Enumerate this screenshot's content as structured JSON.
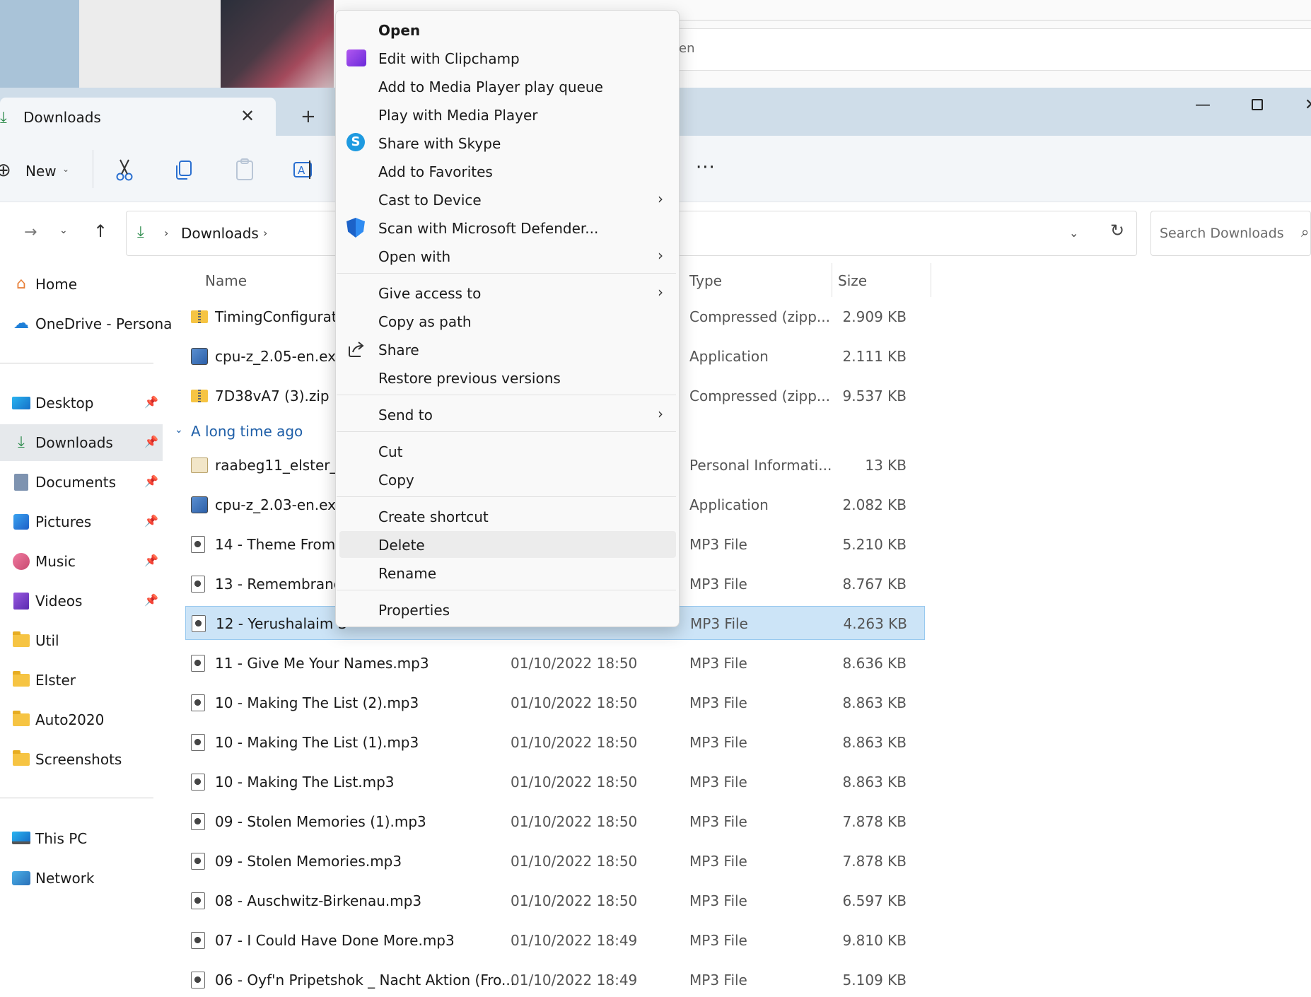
{
  "background": {
    "partial_text": "en"
  },
  "window": {
    "tab_title": "Downloads",
    "tab_close": "✕",
    "tab_add": "+",
    "minimize": "—",
    "close": "✕"
  },
  "toolbar": {
    "new_label": "New",
    "new_chevron": "⌄",
    "more": "···"
  },
  "address": {
    "forward": "→",
    "recent": "⌄",
    "up": "↑",
    "crumb": "Downloads",
    "chevron": "›",
    "dropdown": "⌄",
    "refresh": "↻",
    "search_placeholder": "Search Downloads",
    "search_icon": "⌕"
  },
  "sidebar": {
    "items": [
      {
        "label": "Home",
        "icon": "home-icon"
      },
      {
        "label": "OneDrive - Persona",
        "icon": "onedrive-icon"
      },
      {
        "label": "Desktop",
        "icon": "desktop-icon",
        "pinned": true
      },
      {
        "label": "Downloads",
        "icon": "download-icon",
        "pinned": true,
        "active": true
      },
      {
        "label": "Documents",
        "icon": "documents-icon",
        "pinned": true
      },
      {
        "label": "Pictures",
        "icon": "pictures-icon",
        "pinned": true
      },
      {
        "label": "Music",
        "icon": "music-icon",
        "pinned": true
      },
      {
        "label": "Videos",
        "icon": "videos-icon",
        "pinned": true
      },
      {
        "label": "Util",
        "icon": "folder-icon"
      },
      {
        "label": "Elster",
        "icon": "folder-icon"
      },
      {
        "label": "Auto2020",
        "icon": "folder-icon"
      },
      {
        "label": "Screenshots",
        "icon": "folder-icon"
      },
      {
        "label": "This PC",
        "icon": "pc-icon"
      },
      {
        "label": "Network",
        "icon": "network-icon"
      }
    ]
  },
  "filelist": {
    "headers": {
      "name": "Name",
      "type": "Type",
      "size": "Size"
    },
    "group_label": "A long time ago",
    "group_chevron": "⌄",
    "rows": [
      {
        "name": "TimingConfigurato",
        "date": "",
        "type": "Compressed (zipp...",
        "size": "2.909 KB",
        "icon": "zip"
      },
      {
        "name": "cpu-z_2.05-en.exe",
        "date": "",
        "type": "Application",
        "size": "2.111 KB",
        "icon": "exe"
      },
      {
        "name": "7D38vA7 (3).zip",
        "date": "",
        "type": "Compressed (zipp...",
        "size": "9.537 KB",
        "icon": "zip"
      },
      {
        "name": "raabeg11_elster_3(",
        "date": "",
        "type": "Personal Informati...",
        "size": "13 KB",
        "icon": "pim"
      },
      {
        "name": "cpu-z_2.03-en.exe",
        "date": "",
        "type": "Application",
        "size": "2.082 KB",
        "icon": "exe"
      },
      {
        "name": "14 - Theme From S",
        "date": "",
        "type": "MP3 File",
        "size": "5.210 KB",
        "icon": "mp3"
      },
      {
        "name": "13 - Remembrance",
        "date": "",
        "type": "MP3 File",
        "size": "8.767 KB",
        "icon": "mp3"
      },
      {
        "name": "12 - Yerushalaim S",
        "date": "",
        "type": "MP3 File",
        "size": "4.263 KB",
        "icon": "mp3",
        "selected": true
      },
      {
        "name": "11 - Give Me Your Names.mp3",
        "date": "01/10/2022 18:50",
        "type": "MP3 File",
        "size": "8.636 KB",
        "icon": "mp3"
      },
      {
        "name": "10 - Making The List (2).mp3",
        "date": "01/10/2022 18:50",
        "type": "MP3 File",
        "size": "8.863 KB",
        "icon": "mp3"
      },
      {
        "name": "10 - Making The List (1).mp3",
        "date": "01/10/2022 18:50",
        "type": "MP3 File",
        "size": "8.863 KB",
        "icon": "mp3"
      },
      {
        "name": "10 - Making The List.mp3",
        "date": "01/10/2022 18:50",
        "type": "MP3 File",
        "size": "8.863 KB",
        "icon": "mp3"
      },
      {
        "name": "09 - Stolen Memories (1).mp3",
        "date": "01/10/2022 18:50",
        "type": "MP3 File",
        "size": "7.878 KB",
        "icon": "mp3"
      },
      {
        "name": "09 - Stolen Memories.mp3",
        "date": "01/10/2022 18:50",
        "type": "MP3 File",
        "size": "7.878 KB",
        "icon": "mp3"
      },
      {
        "name": "08 - Auschwitz-Birkenau.mp3",
        "date": "01/10/2022 18:50",
        "type": "MP3 File",
        "size": "6.597 KB",
        "icon": "mp3"
      },
      {
        "name": "07 - I Could Have Done More.mp3",
        "date": "01/10/2022 18:49",
        "type": "MP3 File",
        "size": "9.810 KB",
        "icon": "mp3"
      },
      {
        "name": "06 - Oyf'n Pripetshok _ Nacht Aktion (Fro...",
        "date": "01/10/2022 18:49",
        "type": "MP3 File",
        "size": "5.109 KB",
        "icon": "mp3"
      }
    ]
  },
  "context_menu": {
    "items": [
      {
        "label": "Open",
        "bold": true
      },
      {
        "label": "Edit with Clipchamp",
        "icon": "clipchamp-icon"
      },
      {
        "label": "Add to Media Player play queue"
      },
      {
        "label": "Play with Media Player"
      },
      {
        "label": "Share with Skype",
        "icon": "skype-icon"
      },
      {
        "label": "Add to Favorites"
      },
      {
        "label": "Cast to Device",
        "submenu": true
      },
      {
        "label": "Scan with Microsoft Defender...",
        "icon": "defender-shield-icon"
      },
      {
        "label": "Open with",
        "submenu": true
      },
      {
        "label": "Give access to",
        "submenu": true
      },
      {
        "label": "Copy as path"
      },
      {
        "label": "Share",
        "icon": "share-icon"
      },
      {
        "label": "Restore previous versions"
      },
      {
        "label": "Send to",
        "submenu": true
      },
      {
        "label": "Cut"
      },
      {
        "label": "Copy"
      },
      {
        "label": "Create shortcut"
      },
      {
        "label": "Delete",
        "hover": true
      },
      {
        "label": "Rename"
      },
      {
        "label": "Properties"
      }
    ],
    "submenu_arrow": "›",
    "skype_letter": "S"
  }
}
